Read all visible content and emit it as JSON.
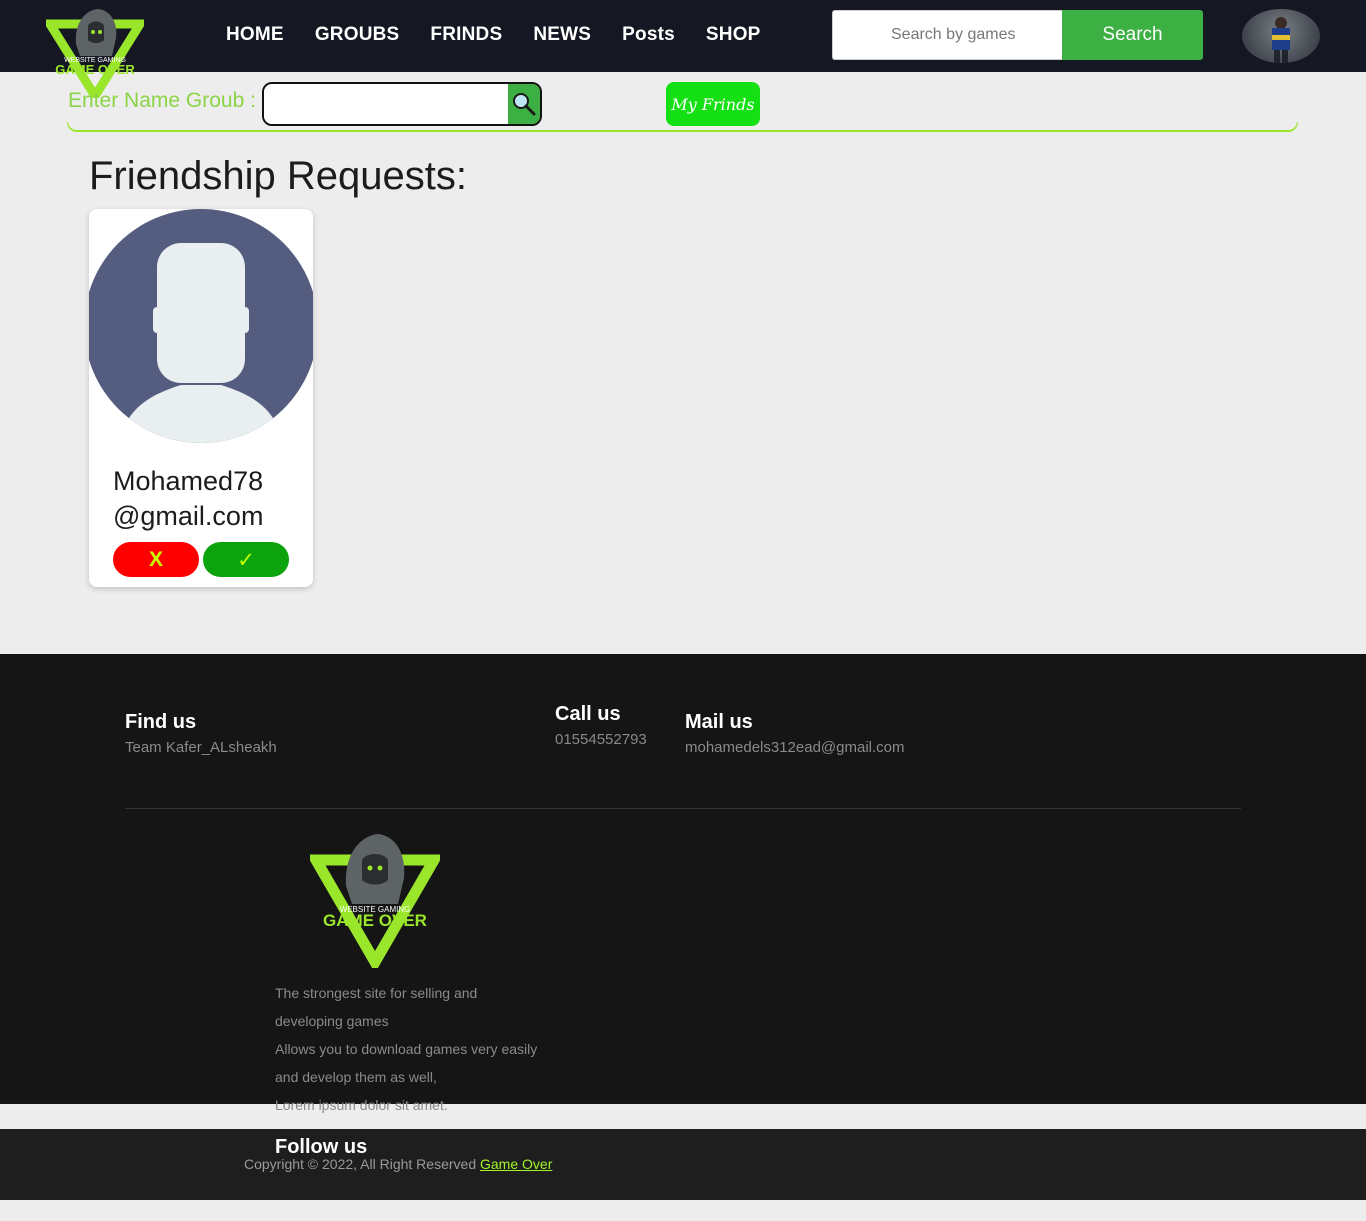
{
  "nav": {
    "links": [
      "HOME",
      "GROUBS",
      "FRINDS",
      "NEWS",
      "Posts",
      "SHOP"
    ],
    "search_placeholder": "Search by games",
    "search_button": "Search"
  },
  "group_bar": {
    "label": "Enter Name Groub :",
    "input_value": "",
    "my_friends_button": "My Frinds"
  },
  "main": {
    "title": "Friendship Requests:",
    "requests": [
      {
        "email_line1": "Mohamed78",
        "email_line2": "@gmail.com",
        "reject_label": "X",
        "accept_label": "✓"
      }
    ]
  },
  "footer": {
    "find_title": "Find us",
    "find_text": "Team Kafer_ALsheakh",
    "call_title": "Call us",
    "call_text": "01554552793",
    "mail_title": "Mail us",
    "mail_text": "mohamedels312ead@gmail.com",
    "desc_line1": "The strongest site for selling and",
    "desc_line2": "developing games",
    "desc_line3": "Allows you to download games very easily",
    "desc_line4": "and develop them as well,",
    "desc_line5": "Lorem ipsum dolor sit amet.",
    "follow_title": "Follow us",
    "copyright_text": "Copyright © 2022, All Right Reserved ",
    "copyright_link": "Game Over"
  },
  "logo": {
    "line1": "WEBSITE GAMING",
    "line2": "GAME OVER"
  },
  "colors": {
    "accent_green": "#3cb043",
    "lime": "#9ae62a",
    "nav_bg": "#151823",
    "footer_bg": "#151515"
  }
}
